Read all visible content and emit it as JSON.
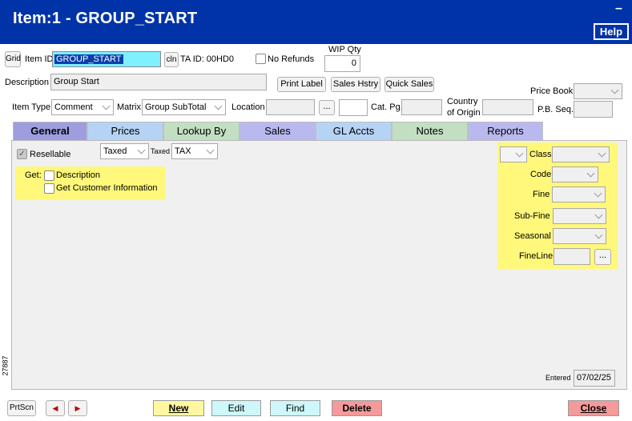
{
  "window": {
    "title": "Item:1 - GROUP_START",
    "minimize": "–",
    "help": "Help"
  },
  "row1": {
    "grid_button": "Grid",
    "item_id_label": "Item ID",
    "item_id_value": "GROUP_START",
    "cln_button": "cln",
    "ta_id": "TA ID: 00HD0",
    "no_refunds_label": "No Refunds",
    "no_refunds_checked": false,
    "wip_qty_label": "WIP Qty",
    "wip_qty_value": "0"
  },
  "row2": {
    "description_label": "Description",
    "description_value": "Group Start",
    "print_label_button": "Print Label",
    "sales_history_button": "Sales Hstry",
    "quick_sales_button": "Quick Sales",
    "price_book_label": "Price Book",
    "price_book_value": ""
  },
  "row3": {
    "item_type_label": "Item Type",
    "item_type_value": "Comment",
    "matrix_label": "Matrix",
    "matrix_value": "Group SubTotal",
    "location_label": "Location",
    "location_value": "",
    "location_browse": "...",
    "cat_pg_label": "Cat. Pg.",
    "cat_pg_value": "",
    "country_label_1": "Country",
    "country_label_2": "of Origin",
    "country_value": "",
    "pb_seq_label": "P.B. Seq.",
    "pb_seq_value": ""
  },
  "tabs": [
    {
      "label": "General",
      "color": "#9d9de0",
      "active": true
    },
    {
      "label": "Prices",
      "color": "#b5d3f5"
    },
    {
      "label": "Lookup By",
      "color": "#c2dfc2"
    },
    {
      "label": "Sales",
      "color": "#b9b9f0"
    },
    {
      "label": "GL Accts",
      "color": "#b5d3f5"
    },
    {
      "label": "Notes",
      "color": "#c2dfc2"
    },
    {
      "label": "Reports",
      "color": "#b9b9f0"
    }
  ],
  "general": {
    "resellable_label": "Resellable",
    "resellable_checked": true,
    "taxed_select": "Taxed",
    "taxed_small_label": "Taxed",
    "tax_select": "TAX",
    "get_label": "Get:",
    "get_description": "Description",
    "get_customer_info": "Get Customer Information",
    "class_label": "Class",
    "code_label": "Code",
    "fine_label": "Fine",
    "subfine_label": "Sub-Fine",
    "seasonal_label": "Seasonal",
    "fineline_label": "FineLine",
    "fineline_browse": "...",
    "vertical_code": "27887",
    "entered_label": "Entered",
    "entered_value": "07/02/25"
  },
  "bottom": {
    "prtscn": "PrtScn",
    "prev_icon": "◀",
    "next_icon": "▶",
    "new": "New",
    "edit": "Edit",
    "find": "Find",
    "delete": "Delete",
    "close": "Close"
  },
  "colors": {
    "title_bar": "#0033a8",
    "highlight_yellow": "#fff87a",
    "new_button": "#fff8a0",
    "edit_find_button": "#cdf7fa",
    "delete_button": "#f49a9a",
    "close_button": "#f49a9a"
  }
}
